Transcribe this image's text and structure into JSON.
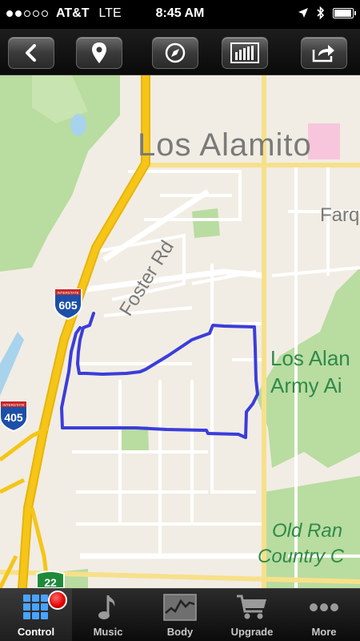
{
  "status_bar": {
    "carrier": "AT&T",
    "network": "LTE",
    "time": "8:45 AM",
    "signal_bars_filled": 2,
    "signal_bars_total": 5,
    "battery_level": 0.95
  },
  "toolbar": {
    "buttons": [
      {
        "name": "back",
        "icon": "chevron-left-icon"
      },
      {
        "name": "location",
        "icon": "map-pin-icon"
      },
      {
        "name": "compass",
        "icon": "compass-icon"
      },
      {
        "name": "stats",
        "icon": "bar-chart-icon"
      },
      {
        "name": "share",
        "icon": "share-icon"
      }
    ]
  },
  "map": {
    "labels": {
      "city": "Los Alamito",
      "street_foster": "Foster Rd",
      "street_farq": "Farq",
      "army_line1": "Los Alan",
      "army_line2": "Army Ai",
      "country_line1": "Old Ran",
      "country_line2": "Country C",
      "sign_605": "605",
      "sign_405": "405",
      "sign_22": "22",
      "interstate": "INTERSTATE"
    },
    "colors": {
      "background": "#f1ede4",
      "park": "#b9dca0",
      "highway": "#f5c518",
      "route": "#3b3ddb",
      "water": "#a8d3ec"
    }
  },
  "tabbar": {
    "tabs": [
      {
        "label": "Control",
        "icon": "grid-icon",
        "active": true,
        "recording": true
      },
      {
        "label": "Music",
        "icon": "music-note-icon",
        "active": false
      },
      {
        "label": "Body",
        "icon": "pulse-chart-icon",
        "active": false
      },
      {
        "label": "Upgrade",
        "icon": "cart-icon",
        "active": false
      },
      {
        "label": "More",
        "icon": "more-dots-icon",
        "active": false
      }
    ]
  }
}
